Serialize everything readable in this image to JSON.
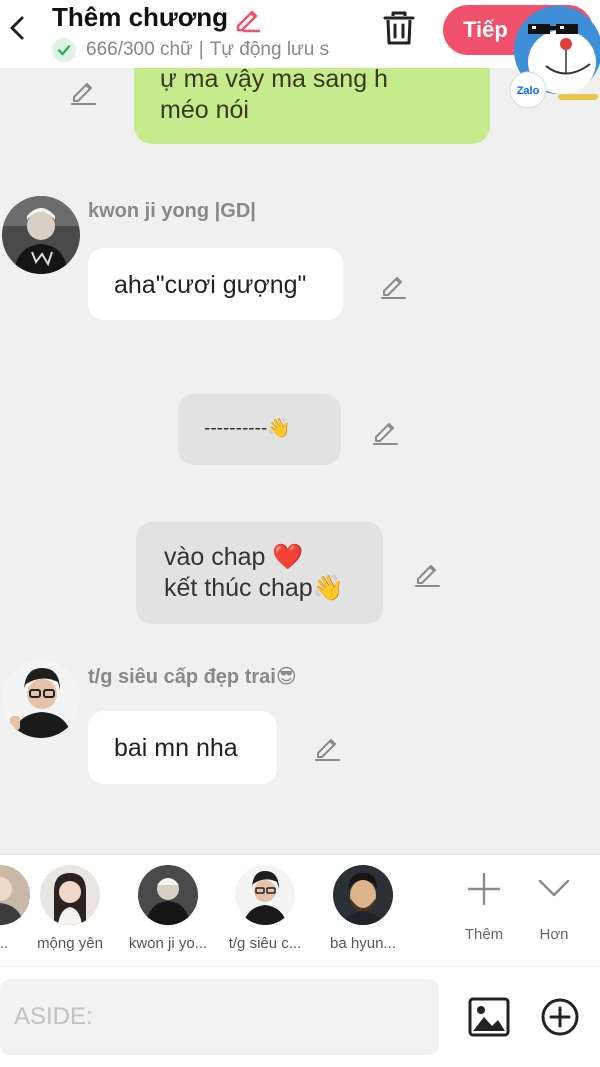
{
  "header": {
    "title": "Thêm chương",
    "word_count": "666/300 chữ",
    "separator": "|",
    "autosave": "Tự động lưu s",
    "next_label": "Tiếp"
  },
  "zalo": {
    "label": "Zalo"
  },
  "chat": {
    "msg1": {
      "line1": "ự ma vậy ma sang h",
      "line2": "méo nói"
    },
    "speaker1": "kwon ji yong |GD|",
    "msg2": "aha\"cươi gượng\"",
    "msg3": "----------👋",
    "msg4": {
      "line1": "vào chap ❤️",
      "line2": "kết thúc chap👋"
    },
    "speaker2": "t/g siêu cấp đẹp trai😎",
    "msg5": "bai mn nha"
  },
  "characters": [
    {
      "name": "t..."
    },
    {
      "name": "mộng yên"
    },
    {
      "name": "kwon ji yo..."
    },
    {
      "name": "t/g siêu c..."
    },
    {
      "name": "ba hyun..."
    }
  ],
  "bar_actions": {
    "add_label": "Thêm",
    "more_label": "Hơn"
  },
  "input": {
    "placeholder": "ASIDE:"
  },
  "colors": {
    "accent": "#f0506a",
    "bubble_green": "#c5eb8c",
    "bubble_gray": "#e2e2e2",
    "background": "#f0f0f0"
  },
  "icons": [
    "back-arrow-icon",
    "pencil-icon",
    "check-icon",
    "trash-icon",
    "plus-icon",
    "chevron-down-icon",
    "image-icon",
    "plus-circle-icon"
  ]
}
